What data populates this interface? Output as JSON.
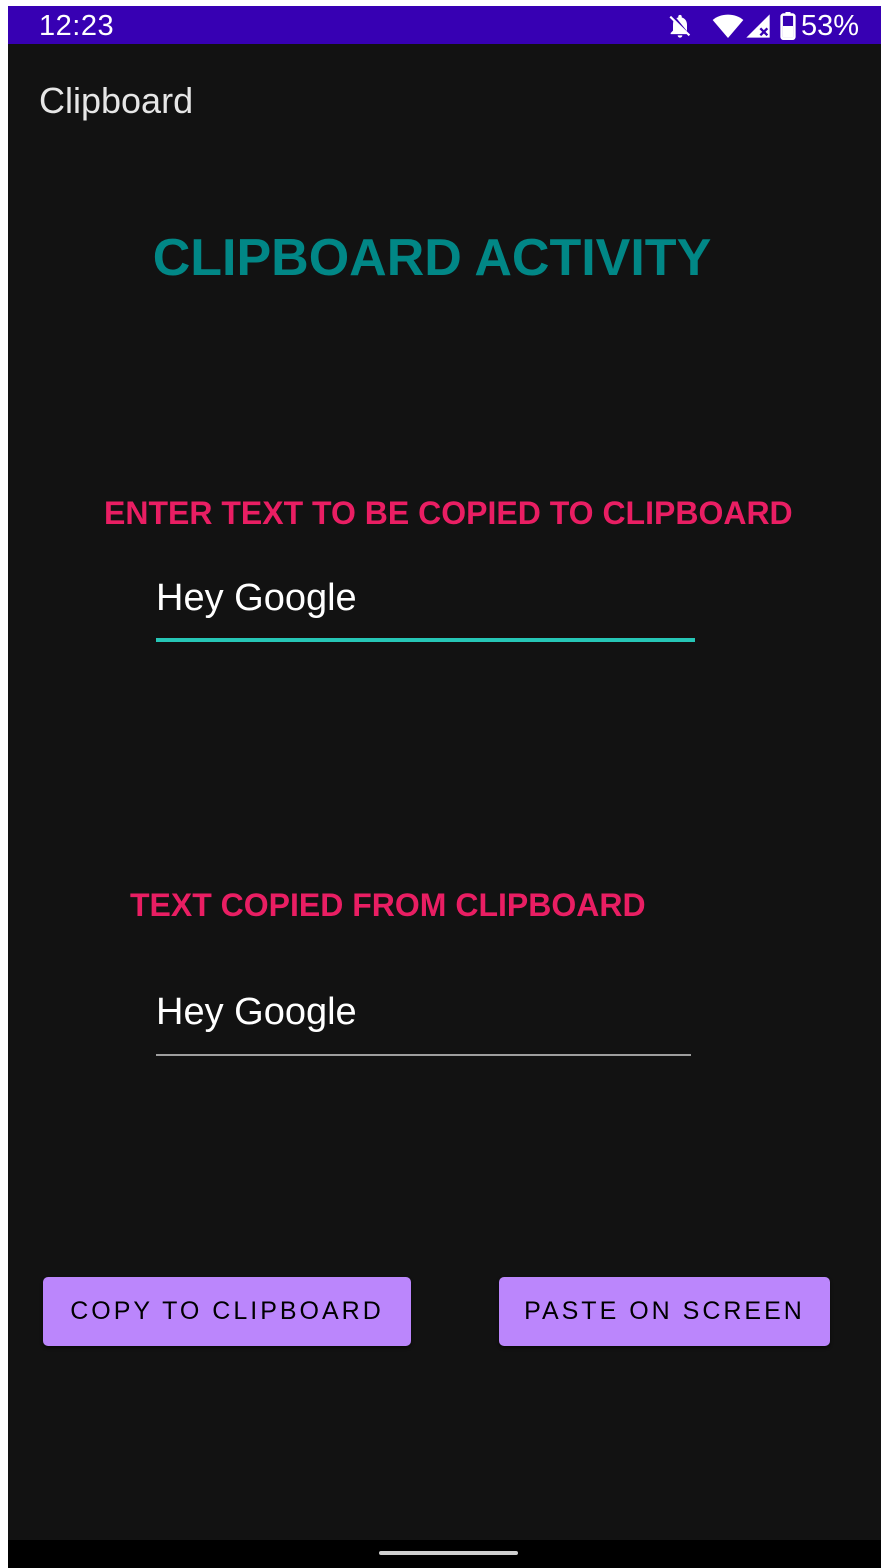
{
  "status_bar": {
    "time": "12:23",
    "battery": "53%",
    "icons": [
      "notifications-off-icon",
      "wifi-icon",
      "cell-signal-icon",
      "battery-icon"
    ],
    "background": "#3700b3"
  },
  "app_bar": {
    "title": "Clipboard"
  },
  "main": {
    "heading": "CLIPBOARD ACTIVITY",
    "input_label": "ENTER TEXT TO BE COPIED TO CLIPBOARD",
    "input_value": "Hey Google",
    "output_label": "TEXT COPIED FROM CLIPBOARD",
    "output_value": "Hey Google"
  },
  "buttons": {
    "copy": "COPY TO CLIPBOARD",
    "paste": "PASTE ON SCREEN"
  },
  "colors": {
    "heading": "#018786",
    "label": "#e91e63",
    "button": "#bb86fc",
    "input_underline": "#26c6b6",
    "background": "#121212"
  }
}
